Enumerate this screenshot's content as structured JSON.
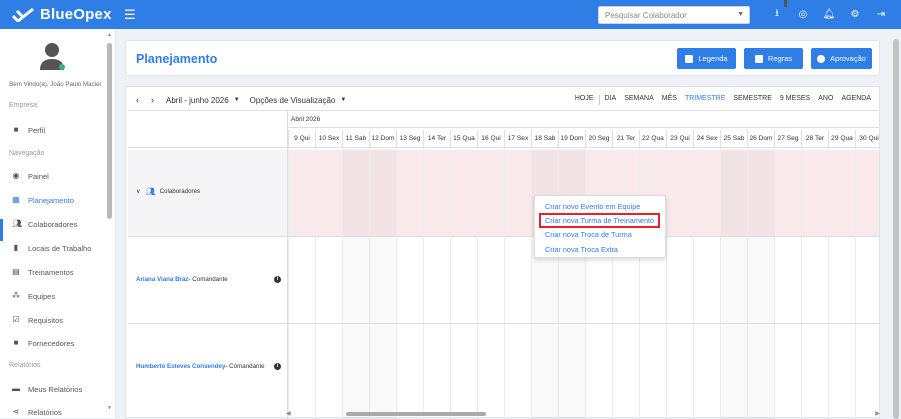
{
  "app": {
    "brand": "BlueOpex"
  },
  "topbar": {
    "search_placeholder": "Pesquisar Colaborador",
    "icons": [
      "download-icon",
      "support-icon",
      "bell-icon",
      "gear-icon",
      "logout-icon"
    ]
  },
  "sidebar": {
    "welcome": "Bem Vindo(a), João Paulo Maciel",
    "sections": {
      "empresa": "Empresa",
      "navegacao": "Navegação",
      "relatorios": "Relatórios"
    },
    "items": [
      {
        "label": "Perfil",
        "icon": "briefcase-icon"
      },
      {
        "label": "Painel",
        "icon": "dashboard-icon"
      },
      {
        "label": "Planejamento",
        "icon": "calendar-icon",
        "active": true
      },
      {
        "label": "Colaboradores",
        "icon": "users-icon"
      },
      {
        "label": "Locais de Trabalho",
        "icon": "building-icon"
      },
      {
        "label": "Treinamentos",
        "icon": "training-icon"
      },
      {
        "label": "Equipes",
        "icon": "team-icon"
      },
      {
        "label": "Requisitos",
        "icon": "checklist-icon"
      },
      {
        "label": "Fornecedores",
        "icon": "supplier-icon"
      },
      {
        "label": "Meus Relatórios",
        "icon": "printer-icon"
      },
      {
        "label": "Relatórios",
        "icon": "share-icon"
      }
    ]
  },
  "header": {
    "title": "Planejamento",
    "buttons": {
      "legenda": "Legenda",
      "regras": "Regras",
      "aprovacao": "Aprovação"
    }
  },
  "calendar": {
    "range": "Abril - junho 2026",
    "view_options": "Opções de Visualização",
    "views": [
      "HOJE",
      "DIA",
      "SEMANA",
      "MÊS",
      "TRIMESTRE",
      "SEMESTRE",
      "9 MESES",
      "ANO",
      "AGENDA"
    ],
    "selected_view": "TRIMESTRE",
    "month": "Abril 2026",
    "days": [
      "9 Qui",
      "10 Sex",
      "11 Sab",
      "12 Dom",
      "13 Seg",
      "14 Ter",
      "15 Qua",
      "16 Qui",
      "17 Sex",
      "18 Sab",
      "19 Dom",
      "20 Seg",
      "21 Ter",
      "22 Qua",
      "23 Qui",
      "24 Sex",
      "25 Sab",
      "26 Dom",
      "27 Seg",
      "28 Ter",
      "29 Qua",
      "30 Qui"
    ],
    "group": "Colaboradores",
    "rows": [
      {
        "name": "Ariana Viana Braz",
        "role": " - Comandante"
      },
      {
        "name": "Humberto Esteves Consendey",
        "role": " - Comandante"
      }
    ]
  },
  "context_menu": [
    "Criar novo Evento em Equipe",
    "Criar nova Turma de Treinamento",
    "Criar nova Troca de Turma",
    "Criar nova Troca Extra"
  ],
  "colors": {
    "accent": "#2f7ee6",
    "highlight": "#e8202a"
  }
}
